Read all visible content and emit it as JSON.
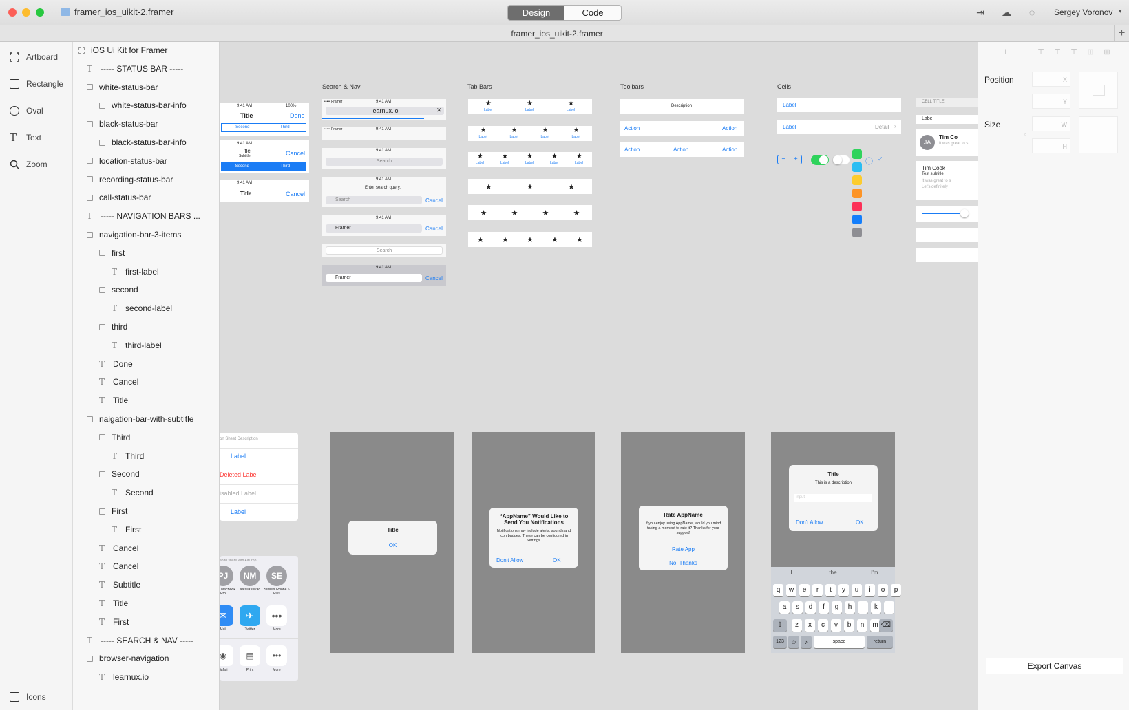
{
  "window": {
    "doc_name": "framer_ios_uikit-2.framer",
    "tab_title": "framer_ios_uikit-2.framer",
    "user": "Sergey Voronov",
    "modes": [
      "Design",
      "Code"
    ],
    "active_mode": "Design"
  },
  "tools": [
    {
      "label": "Artboard",
      "icon": "artboard-icon"
    },
    {
      "label": "Rectangle",
      "icon": "rectangle-icon"
    },
    {
      "label": "Oval",
      "icon": "oval-icon"
    },
    {
      "label": "Text",
      "icon": "text-icon"
    },
    {
      "label": "Zoom",
      "icon": "zoom-icon"
    },
    {
      "label": "Icons",
      "icon": "icons-icon"
    }
  ],
  "layers": [
    {
      "label": "iOS Ui Kit for Framer",
      "type": "artboard",
      "depth": 0
    },
    {
      "label": "----- STATUS BAR -----",
      "type": "text",
      "depth": 1
    },
    {
      "label": "white-status-bar",
      "type": "layer",
      "depth": 1
    },
    {
      "label": "white-status-bar-info",
      "type": "layer",
      "depth": 2
    },
    {
      "label": "black-status-bar",
      "type": "layer",
      "depth": 1
    },
    {
      "label": "black-status-bar-info",
      "type": "layer",
      "depth": 2
    },
    {
      "label": "location-status-bar",
      "type": "layer",
      "depth": 1
    },
    {
      "label": "recording-status-bar",
      "type": "layer",
      "depth": 1
    },
    {
      "label": "call-status-bar",
      "type": "layer",
      "depth": 1
    },
    {
      "label": "----- NAVIGATION BARS ...",
      "type": "text",
      "depth": 1
    },
    {
      "label": "navigation-bar-3-items",
      "type": "layer",
      "depth": 1
    },
    {
      "label": "first",
      "type": "layer",
      "depth": 2
    },
    {
      "label": "first-label",
      "type": "text",
      "depth": 3
    },
    {
      "label": "second",
      "type": "layer",
      "depth": 2
    },
    {
      "label": "second-label",
      "type": "text",
      "depth": 3
    },
    {
      "label": "third",
      "type": "layer",
      "depth": 2
    },
    {
      "label": "third-label",
      "type": "text",
      "depth": 3
    },
    {
      "label": "Done",
      "type": "text",
      "depth": 2
    },
    {
      "label": "Cancel",
      "type": "text",
      "depth": 2
    },
    {
      "label": "Title",
      "type": "text",
      "depth": 2
    },
    {
      "label": "naigation-bar-with-subtitle",
      "type": "layer",
      "depth": 1
    },
    {
      "label": "Third",
      "type": "layer",
      "depth": 2
    },
    {
      "label": "Third",
      "type": "text",
      "depth": 3
    },
    {
      "label": "Second",
      "type": "layer",
      "depth": 2
    },
    {
      "label": "Second",
      "type": "text",
      "depth": 3
    },
    {
      "label": "First",
      "type": "layer",
      "depth": 2
    },
    {
      "label": "First",
      "type": "text",
      "depth": 3
    },
    {
      "label": "Cancel",
      "type": "text",
      "depth": 2
    },
    {
      "label": "Cancel",
      "type": "text",
      "depth": 2
    },
    {
      "label": "Subtitle",
      "type": "text",
      "depth": 2
    },
    {
      "label": "Title",
      "type": "text",
      "depth": 2
    },
    {
      "label": "First",
      "type": "text",
      "depth": 2
    },
    {
      "label": "----- SEARCH & NAV -----",
      "type": "text",
      "depth": 1
    },
    {
      "label": "browser-navigation",
      "type": "layer",
      "depth": 1
    },
    {
      "label": "learnux.io",
      "type": "text",
      "depth": 2
    }
  ],
  "canvas": {
    "sections": {
      "search_nav": "Search & Nav",
      "tab_bars": "Tab Bars",
      "toolbars": "Toolbars",
      "cells": "Cells",
      "cell_title": "CELL TITLE"
    },
    "status": {
      "carrier": "••••• Framer",
      "time": "9:41 AM",
      "battery": "100%"
    },
    "nav": {
      "title": "Title",
      "done": "Done",
      "cancel": "Cancel",
      "subtitle": "Subtitle",
      "seg": [
        "Second",
        "Third"
      ]
    },
    "search": {
      "url": "learnux.io",
      "placeholder": "Search",
      "query": "Framer",
      "cancel": "Cancel",
      "prompt": "Enter search query."
    },
    "tab_label": "Label",
    "toolbars": {
      "description": "Description",
      "action": "Action"
    },
    "cells": {
      "label": "Label",
      "detail": "Detail",
      "name": "Tim Cook",
      "subtitle": "Test subtitle",
      "preview": "It was great to s",
      "preview2": "Let's definitely",
      "initials": "JA",
      "short": "Tim Co"
    },
    "action_sheet": {
      "description": "Action Sheet Description",
      "label": "Label",
      "deleted": "Deleted Label",
      "disabled": "Disabled Label"
    },
    "share": {
      "title": "Tap to share with AirDrop",
      "people": [
        {
          "initials": "PJ",
          "name": "Paul's MacBook Pro"
        },
        {
          "initials": "NM",
          "name": "Natalia's iPad"
        },
        {
          "initials": "SE",
          "name": "Susie's iPhone 6 Plus"
        }
      ],
      "apps": [
        "Mail",
        "Twitter",
        "More"
      ],
      "actions": [
        "Safari",
        "Print",
        "More"
      ]
    },
    "alert1": {
      "title": "Title",
      "ok": "OK"
    },
    "alert2": {
      "title": "“AppName” Would Like to Send You Notifications",
      "body": "Notifications may include alerts, sounds and icon badges. These can be configured in Settings.",
      "deny": "Don't Allow",
      "ok": "OK"
    },
    "alert3": {
      "title": "Rate AppName",
      "body": "If you enjoy using AppName, would you mind taking a moment to rate it? Thanks for your support!",
      "rate": "Rate App",
      "no": "No, Thanks"
    },
    "alert4": {
      "title": "Title",
      "desc": "This is a description",
      "input": "input",
      "deny": "Don't Allow",
      "ok": "OK"
    },
    "keyboard": {
      "suggestions": [
        "I",
        "the",
        "I'm"
      ],
      "row1": [
        "q",
        "w",
        "e",
        "r",
        "t",
        "y",
        "u",
        "i",
        "o",
        "p"
      ],
      "row2": [
        "a",
        "s",
        "d",
        "f",
        "g",
        "h",
        "j",
        "k",
        "l"
      ],
      "row3": [
        "z",
        "x",
        "c",
        "v",
        "b",
        "n",
        "m"
      ],
      "num": "123",
      "space": "space",
      "return": "return"
    },
    "colors": [
      "#2fd35c",
      "#2bbdf3",
      "#fccc2e",
      "#fd9426",
      "#fc3158",
      "#147efb",
      "#8e8e93"
    ]
  },
  "props": {
    "position": "Position",
    "size": "Size",
    "x": "X",
    "y": "Y",
    "w": "W",
    "h": "H",
    "export": "Export Canvas"
  }
}
